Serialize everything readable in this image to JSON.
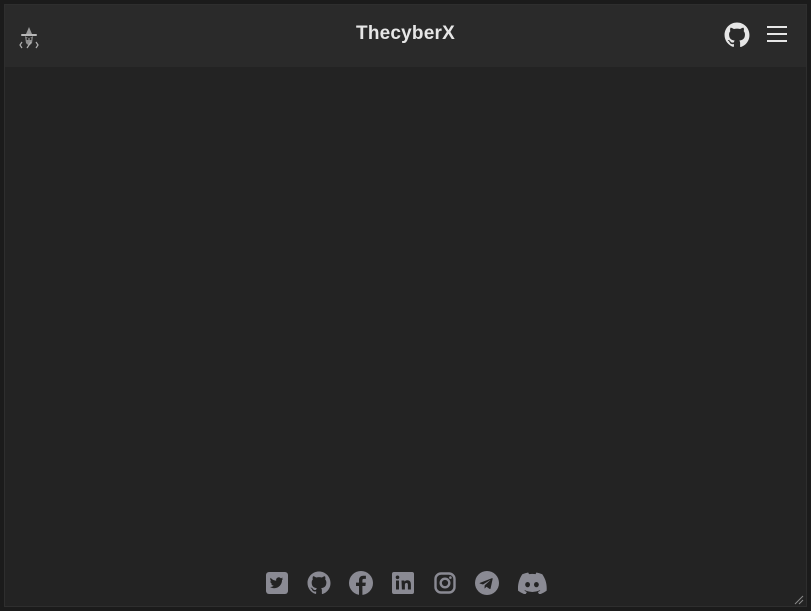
{
  "header": {
    "title": "ThecyberX",
    "logo_icon": "hacker-logo-icon",
    "github_icon": "github-icon",
    "menu_icon": "hamburger-menu-icon"
  },
  "footer": {
    "social_icons": [
      "twitter-icon",
      "github-icon",
      "facebook-icon",
      "linkedin-icon",
      "instagram-icon",
      "telegram-icon",
      "discord-icon"
    ]
  },
  "colors": {
    "background": "#232323",
    "header": "#2a2a2a",
    "title": "#e6e6e6",
    "icon_header": "#e0e0e0",
    "icon_footer": "#8a8a93"
  }
}
